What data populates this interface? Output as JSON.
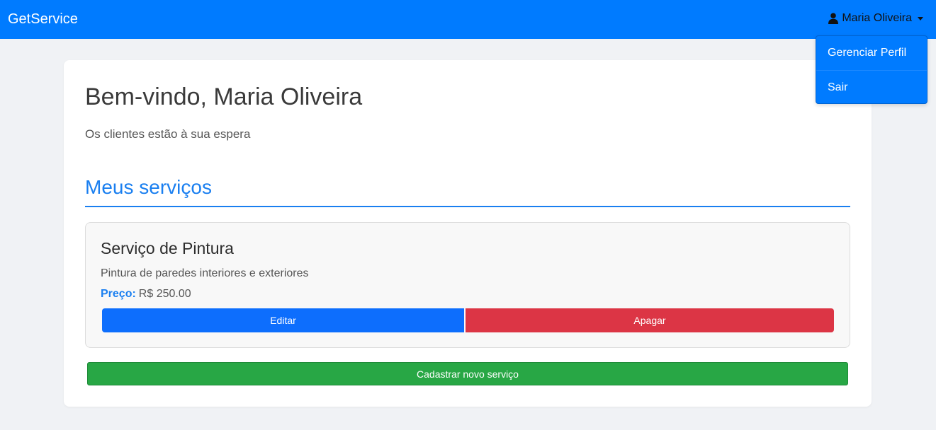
{
  "navbar": {
    "brand": "GetService",
    "user_name": "Maria Oliveira",
    "user_icon": "user-icon",
    "caret_icon": "caret-down-icon"
  },
  "user_menu": {
    "items": [
      {
        "label": "Gerenciar Perfil"
      },
      {
        "label": "Sair"
      }
    ]
  },
  "main": {
    "welcome": "Bem-vindo, Maria Oliveira",
    "subtitle": "Os clientes estão à sua espera",
    "section_title": "Meus serviços",
    "services": [
      {
        "name": "Serviço de Pintura",
        "description": "Pintura de paredes interiores e exteriores",
        "price_label": "Preço:",
        "price_value": "R$ 250.00",
        "edit_label": "Editar",
        "delete_label": "Apagar"
      }
    ],
    "new_service_label": "Cadastrar novo serviço"
  },
  "colors": {
    "navbar": "#007bff",
    "accent": "#1a7ff0",
    "edit": "#0d6efd",
    "delete": "#dc3545",
    "new": "#28a745",
    "background": "#f0f2f5"
  }
}
